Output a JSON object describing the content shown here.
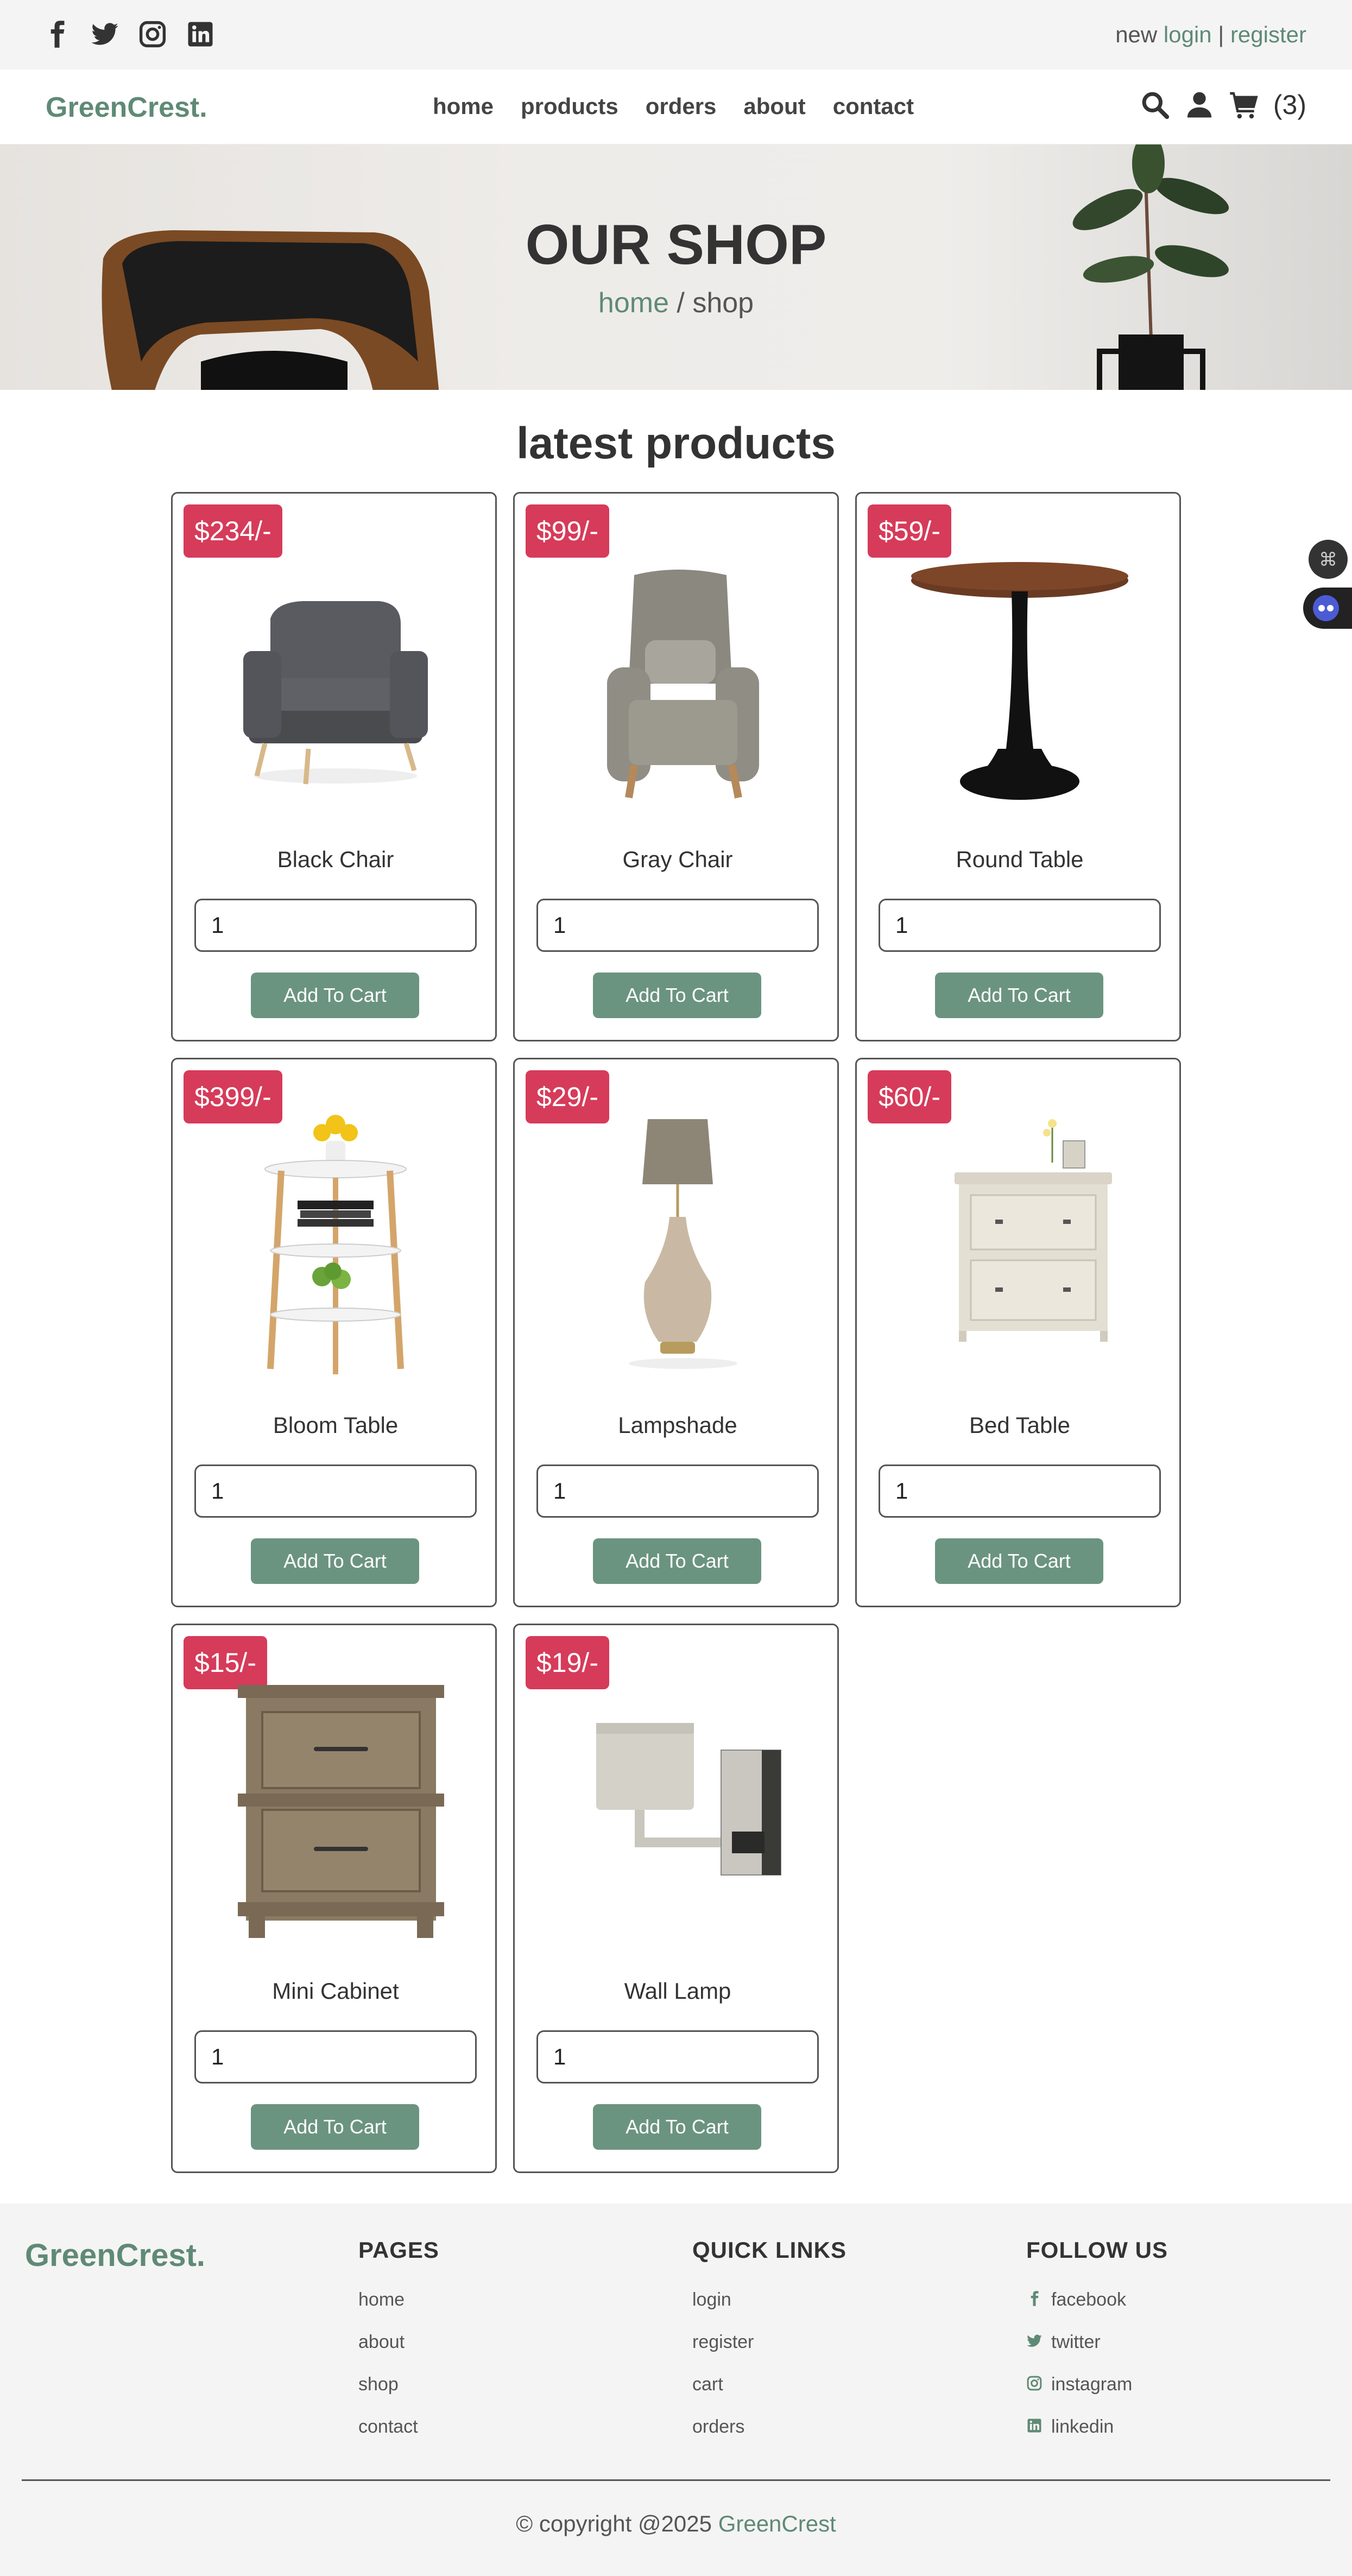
{
  "topbar": {
    "social_icons": [
      "facebook-icon",
      "twitter-icon",
      "instagram-icon",
      "linkedin-icon"
    ],
    "auth_prefix": "new",
    "login_label": "login",
    "separator": "|",
    "register_label": "register"
  },
  "navbar": {
    "logo": "GreenCrest.",
    "links": [
      "home",
      "products",
      "orders",
      "about",
      "contact"
    ],
    "cart_count": "(3)"
  },
  "hero": {
    "title": "OUR SHOP",
    "crumb_home": "home",
    "crumb_sep": " / ",
    "crumb_current": "shop"
  },
  "section_title": "latest products",
  "products": [
    {
      "price": "$234/-",
      "name": "Black Chair",
      "qty": "1",
      "button": "Add To Cart"
    },
    {
      "price": "$99/-",
      "name": "Gray Chair",
      "qty": "1",
      "button": "Add To Cart"
    },
    {
      "price": "$59/-",
      "name": "Round Table",
      "qty": "1",
      "button": "Add To Cart"
    },
    {
      "price": "$399/-",
      "name": "Bloom Table",
      "qty": "1",
      "button": "Add To Cart"
    },
    {
      "price": "$29/-",
      "name": "Lampshade",
      "qty": "1",
      "button": "Add To Cart"
    },
    {
      "price": "$60/-",
      "name": "Bed Table",
      "qty": "1",
      "button": "Add To Cart"
    },
    {
      "price": "$15/-",
      "name": "Mini Cabinet",
      "qty": "1",
      "button": "Add To Cart"
    },
    {
      "price": "$19/-",
      "name": "Wall Lamp",
      "qty": "1",
      "button": "Add To Cart"
    }
  ],
  "footer": {
    "logo": "GreenCrest.",
    "pages_title": "PAGES",
    "pages": [
      "home",
      "about",
      "shop",
      "contact"
    ],
    "quick_title": "QUICK LINKS",
    "quick": [
      "login",
      "register",
      "cart",
      "orders"
    ],
    "follow_title": "FOLLOW US",
    "follow": [
      "facebook",
      "twitter",
      "instagram",
      "linkedin"
    ],
    "copyright_prefix": "© copyright @2025 ",
    "copyright_brand": "GreenCrest"
  },
  "colors": {
    "accent": "#5f8a76",
    "price_badge": "#d63b5a",
    "button": "#6b9480"
  }
}
